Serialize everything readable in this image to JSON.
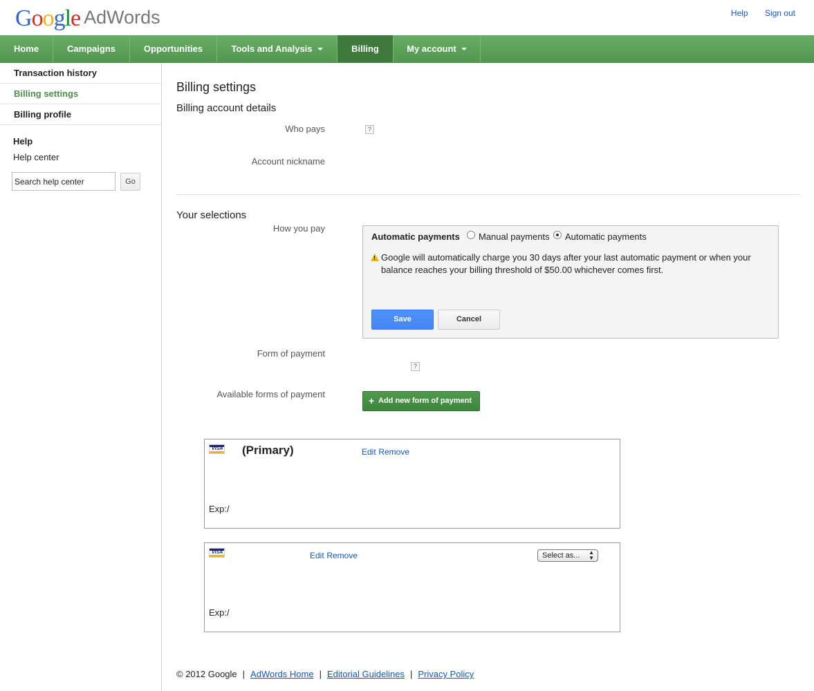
{
  "header": {
    "logo_google": [
      "G",
      "o",
      "o",
      "g",
      "l",
      "e"
    ],
    "logo_product": "AdWords",
    "links": {
      "help": "Help",
      "sign_out": "Sign out"
    }
  },
  "nav": {
    "items": [
      {
        "label": "Home"
      },
      {
        "label": "Campaigns"
      },
      {
        "label": "Opportunities"
      },
      {
        "label": "Tools and Analysis"
      },
      {
        "label": "Billing"
      },
      {
        "label": "My account"
      }
    ]
  },
  "sidebar": {
    "items": [
      {
        "label": "Transaction history"
      },
      {
        "label": "Billing settings"
      },
      {
        "label": "Billing profile"
      }
    ],
    "help_title": "Help",
    "help_center": "Help center",
    "search_value": "Search help center",
    "go_label": "Go"
  },
  "main": {
    "title": "Billing settings",
    "account_details_heading": "Billing account details",
    "who_pays_label": "Who pays",
    "account_nickname_label": "Account nickname",
    "selections_heading": "Your selections",
    "how_you_pay_label": "How you pay",
    "payment_box": {
      "title": "Automatic payments",
      "option_manual": "Manual payments",
      "option_automatic": "Automatic payments",
      "warning_text": "Google will automatically charge you 30 days after your last automatic payment or when your balance reaches your billing threshold of $50.00 whichever comes first.",
      "save_label": "Save",
      "cancel_label": "Cancel"
    },
    "form_of_payment_label": "Form of payment",
    "available_forms_label": "Available forms of payment",
    "add_payment_label": "Add new form of payment",
    "help_mark": "?",
    "cards": [
      {
        "card_type": "VISA",
        "primary": "(Primary)",
        "edit": "Edit",
        "remove": "Remove",
        "exp": "Exp:/"
      },
      {
        "card_type": "VISA",
        "edit": "Edit",
        "remove": "Remove",
        "exp": "Exp:/",
        "select_value": "Select as..."
      }
    ]
  },
  "footer": {
    "copyright": "© 2012 Google",
    "links": [
      "AdWords Home",
      "Editorial Guidelines",
      "Privacy Policy"
    ]
  },
  "colors": {
    "nav_green": "#5da35b",
    "nav_active": "#3f7a3d",
    "link_blue": "#1155cc",
    "save_blue": "#4d90fe",
    "add_green": "#4e9a4c",
    "sidebar_active": "#4b8e49"
  }
}
